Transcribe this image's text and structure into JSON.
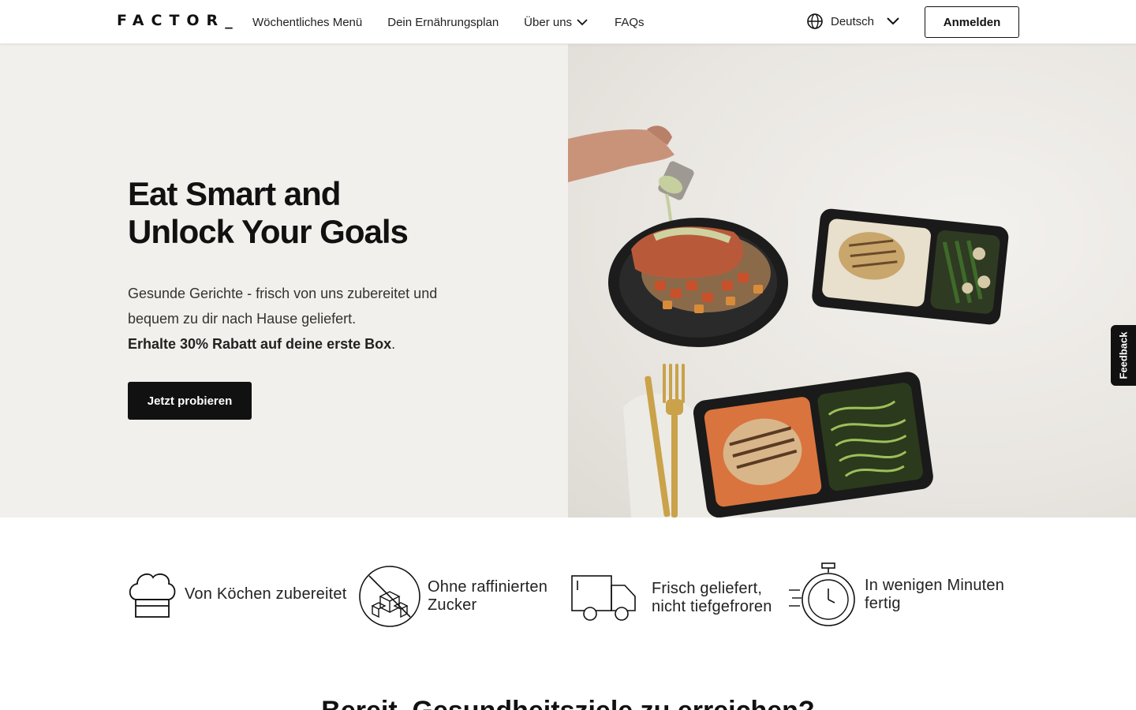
{
  "header": {
    "logo": "FACTOR_",
    "nav": [
      {
        "label": "Wöchentliches Menü"
      },
      {
        "label": "Dein Ernährungsplan"
      },
      {
        "label": "Über uns"
      },
      {
        "label": "FAQs"
      }
    ],
    "language": "Deutsch",
    "login_label": "Anmelden"
  },
  "hero": {
    "title_line1": "Eat Smart and",
    "title_line2": "Unlock Your Goals",
    "subtitle": "Gesunde Gerichte - frisch von uns zubereitet und bequem zu dir nach Hause geliefert.",
    "discount": "Erhalte 30% Rabatt auf deine erste Box",
    "discount_suffix": ".",
    "cta_label": "Jetzt probieren"
  },
  "feedback_label": "Feedback",
  "features": [
    {
      "icon": "chef-hat-icon",
      "line1": "Von Köchen zubereitet",
      "line2": ""
    },
    {
      "icon": "no-sugar-icon",
      "line1": "Ohne raffinierten",
      "line2": "Zucker"
    },
    {
      "icon": "delivery-truck-icon",
      "line1": "Frisch geliefert,",
      "line2": "nicht tiefgefroren"
    },
    {
      "icon": "stopwatch-icon",
      "line1": "In wenigen Minuten",
      "line2": "fertig"
    }
  ],
  "next_section_heading": "Bereit, Gesundheitsziele zu erreichen?",
  "colors": {
    "accent": "#111111",
    "hero_bg": "#f1f0ec"
  }
}
